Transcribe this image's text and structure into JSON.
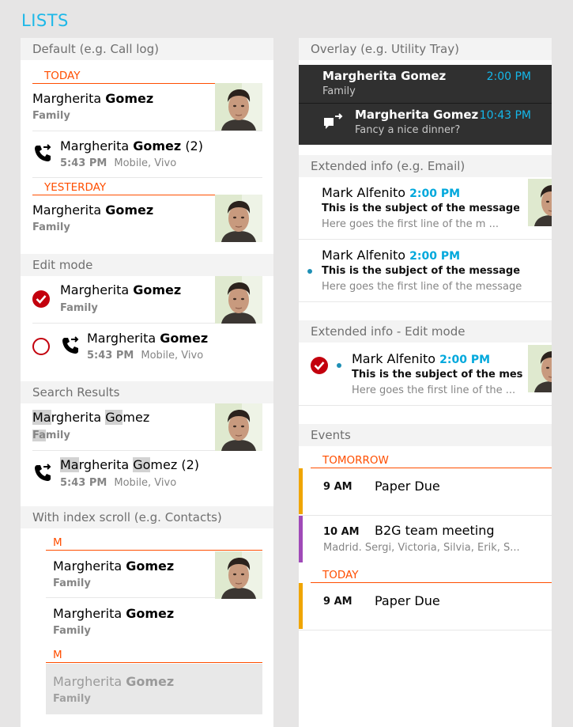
{
  "page_title": "LISTS",
  "left": {
    "default": {
      "header": "Default (e.g. Call log)",
      "group_today": "TODAY",
      "group_yesterday": "YESTERDAY",
      "contact1": {
        "first": "Margherita",
        "last": "Gomez",
        "sub": "Family"
      },
      "call1": {
        "first": "Margherita",
        "last": "Gomez",
        "count": "(2)",
        "time": "5:43 PM",
        "detail": "Mobile, Vivo"
      },
      "contact2": {
        "first": "Margherita",
        "last": "Gomez",
        "sub": "Family"
      }
    },
    "edit": {
      "header": "Edit mode",
      "contact": {
        "first": "Margherita",
        "last": "Gomez",
        "sub": "Family"
      },
      "call": {
        "first": "Margherita",
        "last": "Gomez",
        "time": "5:43 PM",
        "detail": "Mobile, Vivo"
      }
    },
    "search": {
      "header": "Search Results",
      "contact": {
        "hl1": "Ma",
        "rest1": "rgherita ",
        "hl2": "Go",
        "rest2": "mez",
        "sub_hl": "Fa",
        "sub_rest": "mily"
      },
      "call": {
        "hl1": "Ma",
        "rest1": "rgherita ",
        "hl2": "Go",
        "rest2": "mez",
        "count": "(2)",
        "time": "5:43 PM",
        "detail": "Mobile, Vivo"
      }
    },
    "index": {
      "header": "With index scroll (e.g. Contacts)",
      "group1": "M",
      "group2": "M",
      "contact1": {
        "first": "Margherita",
        "last": "Gomez",
        "sub": "Family"
      },
      "contact2": {
        "first": "Margherita",
        "last": "Gomez",
        "sub": "Family"
      },
      "contact3": {
        "first": "Margherita",
        "last": "Gomez",
        "sub": "Family"
      }
    }
  },
  "right": {
    "overlay": {
      "header": "Overlay (e.g. Utility Tray)",
      "item1": {
        "name": "Margherita Gomez",
        "time": "2:00 PM",
        "sub": "Family"
      },
      "item2": {
        "name": "Margherita Gomez",
        "time": "10:43 PM",
        "sub": "Fancy a nice dinner?"
      }
    },
    "extended": {
      "header": "Extended info (e.g. Email)",
      "email1": {
        "from": "Mark Alfenito",
        "time": "2:00 PM",
        "subject": "This is the subject of the message",
        "line": "Here goes the first line of the m ..."
      },
      "email2": {
        "from": "Mark Alfenito",
        "time": "2:00 PM",
        "subject": "This is the subject of the message",
        "line": "Here goes the first line of the message"
      }
    },
    "extended_edit": {
      "header": "Extended info - Edit mode",
      "email": {
        "from": "Mark Alfenito",
        "time": "2:00 PM",
        "subject": "This is the subject of the mes ...",
        "line": "Here goes the first line of the ..."
      }
    },
    "events": {
      "header": "Events",
      "group_tomorrow": "TOMORROW",
      "group_today": "TODAY",
      "event1": {
        "time": "9 AM",
        "title": "Paper Due",
        "color": "#f0a500"
      },
      "event2": {
        "time": "10 AM",
        "title": "B2G team meeting",
        "sub": "Madrid. Sergi, Victoria, Silvia, Erik, S...",
        "color": "#a04ab8"
      },
      "event3": {
        "time": "9 AM",
        "title": "Paper Due",
        "color": "#f0a500"
      }
    }
  },
  "colors": {
    "accent_orange": "#ff4e00",
    "accent_blue": "#1eb8e8",
    "check_red": "#c3000d",
    "overlay_bg": "#303030"
  }
}
